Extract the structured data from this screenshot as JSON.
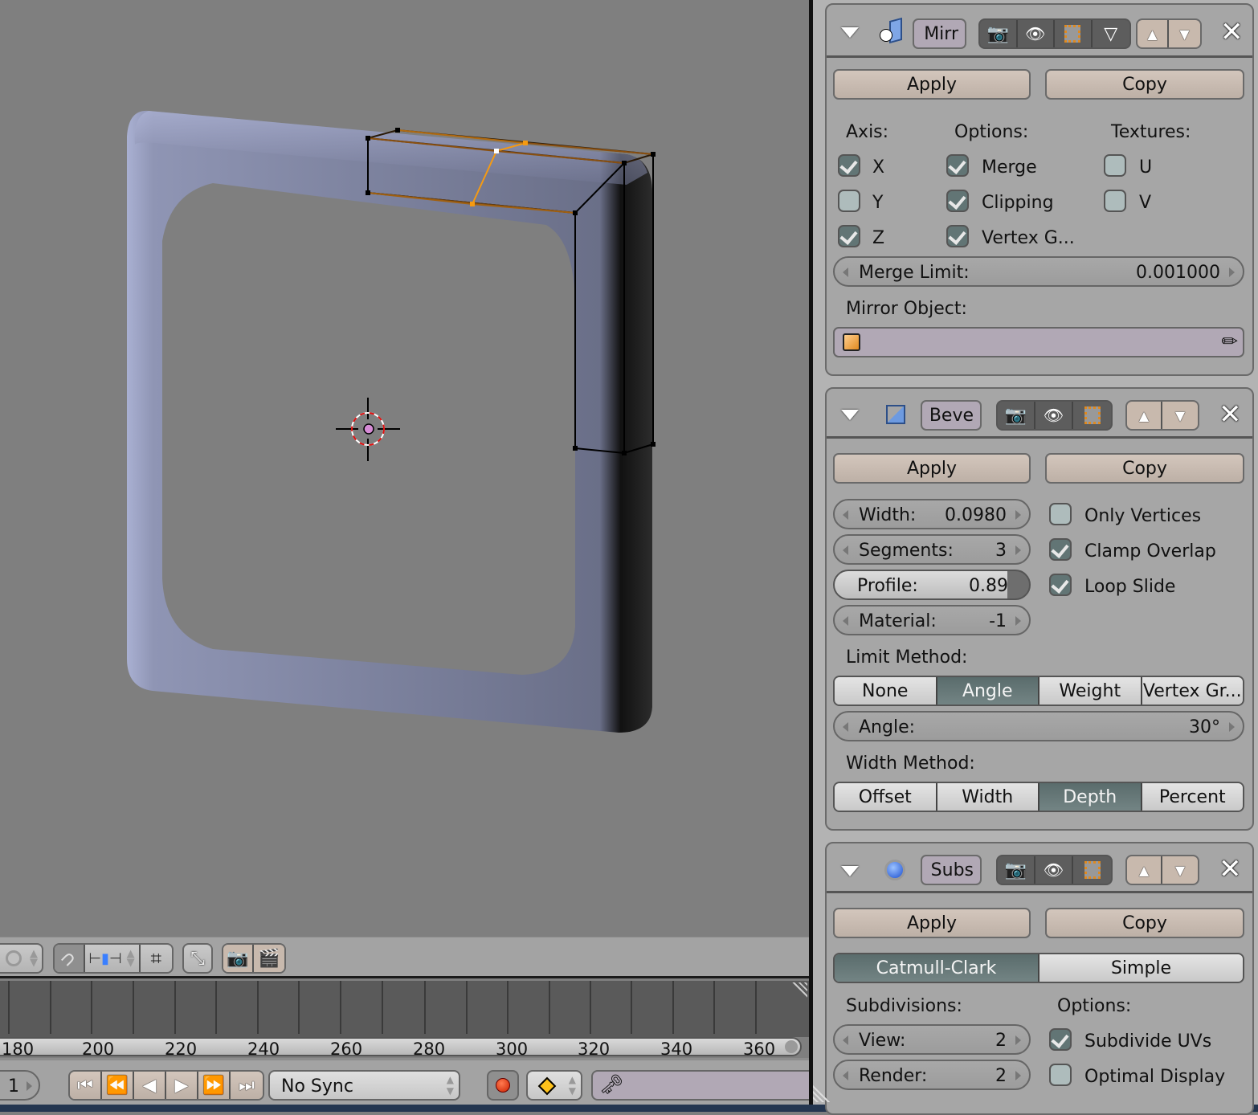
{
  "viewport": {
    "object": "rounded frame mesh",
    "mode": "edit",
    "colors": {
      "mesh": "#a9b0d2",
      "selected_edge": "#f59a12",
      "vertex": "#000000",
      "background": "#7f7f7f"
    }
  },
  "view_toolbar": {
    "icons": [
      "pivot-icon",
      "snap-magnet-icon",
      "snap-element-icon",
      "snap-target-icon",
      "scale-icon",
      "render-still-icon",
      "render-animation-icon"
    ]
  },
  "timeline": {
    "ruler_labels": [
      "180",
      "200",
      "220",
      "240",
      "260",
      "280",
      "300",
      "320",
      "340",
      "360"
    ],
    "current_frame": "1",
    "playback_buttons": [
      "jump-start",
      "prev-keyframe",
      "play-reverse",
      "play",
      "next-keyframe",
      "jump-end"
    ],
    "sync_mode": "No Sync",
    "record_icon": "record-icon",
    "keyframe_icon": "keyframe-icon",
    "keying_set_icon": "keying-set-icon"
  },
  "modifiers": [
    {
      "name": "Mirr",
      "type_icon": "mirror-modifier-icon",
      "apply_label": "Apply",
      "copy_label": "Copy",
      "axis_label": "Axis:",
      "options_label": "Options:",
      "textures_label": "Textures:",
      "axis": [
        {
          "label": "X",
          "checked": true
        },
        {
          "label": "Y",
          "checked": false
        },
        {
          "label": "Z",
          "checked": true
        }
      ],
      "options": [
        {
          "label": "Merge",
          "checked": true
        },
        {
          "label": "Clipping",
          "checked": true
        },
        {
          "label": "Vertex G...",
          "checked": true
        }
      ],
      "textures": [
        {
          "label": "U",
          "checked": false
        },
        {
          "label": "V",
          "checked": false
        }
      ],
      "merge_limit": {
        "label": "Merge Limit:",
        "value": "0.001000"
      },
      "mirror_object_label": "Mirror Object:",
      "mirror_object_value": ""
    },
    {
      "name": "Beve",
      "type_icon": "bevel-modifier-icon",
      "apply_label": "Apply",
      "copy_label": "Copy",
      "width": {
        "label": "Width:",
        "value": "0.0980"
      },
      "segments": {
        "label": "Segments:",
        "value": "3"
      },
      "profile": {
        "label": "Profile:",
        "value": "0.89",
        "fraction": 0.89
      },
      "material": {
        "label": "Material:",
        "value": "-1"
      },
      "checks": [
        {
          "label": "Only Vertices",
          "checked": false
        },
        {
          "label": "Clamp Overlap",
          "checked": true
        },
        {
          "label": "Loop Slide",
          "checked": true
        }
      ],
      "limit_method_label": "Limit Method:",
      "limit_methods": [
        {
          "label": "None",
          "active": false
        },
        {
          "label": "Angle",
          "active": true
        },
        {
          "label": "Weight",
          "active": false
        },
        {
          "label": "Vertex Gr...",
          "active": false
        }
      ],
      "angle": {
        "label": "Angle:",
        "value": "30°"
      },
      "width_method_label": "Width Method:",
      "width_methods": [
        {
          "label": "Offset",
          "active": false
        },
        {
          "label": "Width",
          "active": false
        },
        {
          "label": "Depth",
          "active": true
        },
        {
          "label": "Percent",
          "active": false
        }
      ]
    },
    {
      "name": "Subs",
      "type_icon": "subsurf-modifier-icon",
      "apply_label": "Apply",
      "copy_label": "Copy",
      "algorithms": [
        {
          "label": "Catmull-Clark",
          "active": true
        },
        {
          "label": "Simple",
          "active": false
        }
      ],
      "subdivisions_label": "Subdivisions:",
      "options_label": "Options:",
      "view": {
        "label": "View:",
        "value": "2"
      },
      "render": {
        "label": "Render:",
        "value": "2"
      },
      "checks": [
        {
          "label": "Subdivide UVs",
          "checked": true
        },
        {
          "label": "Optimal Display",
          "checked": false
        }
      ]
    }
  ]
}
